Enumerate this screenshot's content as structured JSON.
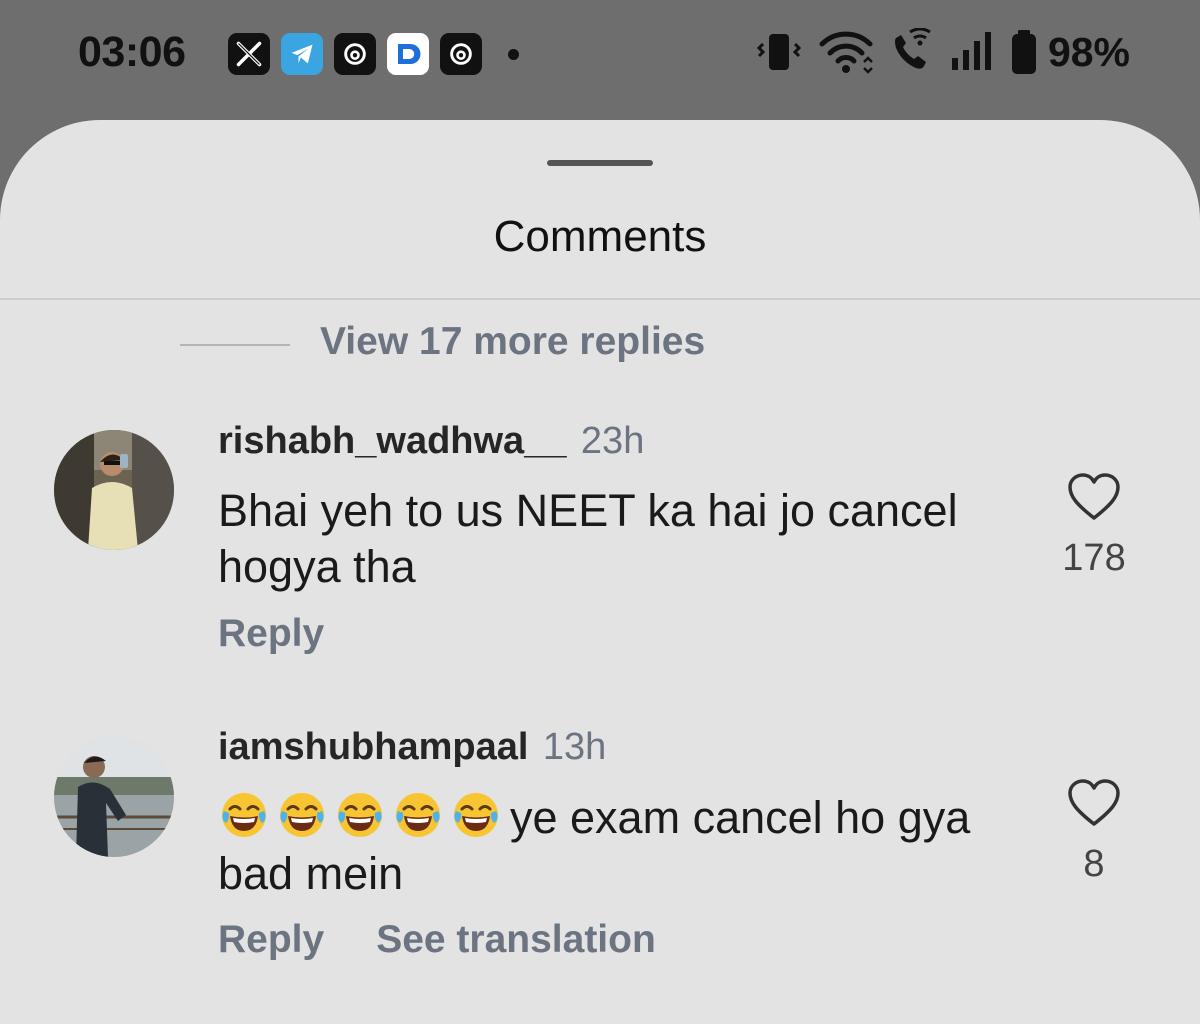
{
  "status_bar": {
    "time": "03:06",
    "notification_icons": [
      "x-icon",
      "telegram-icon",
      "threads-icon",
      "app-icon",
      "threads-icon"
    ],
    "battery": "98%"
  },
  "sheet": {
    "title": "Comments",
    "view_more": "View 17 more replies"
  },
  "comments": [
    {
      "username": "rishabh_wadhwa__",
      "time": "23h",
      "line1": "Bhai yeh to us NEET ka hai jo cancel",
      "line2": "hogya tha",
      "likes": "178",
      "reply": "Reply"
    },
    {
      "username": "iamshubhampaal",
      "time": "13h",
      "emoji": "face-with-tears-of-joy-icon",
      "emoji_count": 5,
      "line1_text": "ye exam cancel ho gya",
      "line2": "bad mein",
      "likes": "8",
      "reply": "Reply",
      "translate": "See translation"
    }
  ]
}
